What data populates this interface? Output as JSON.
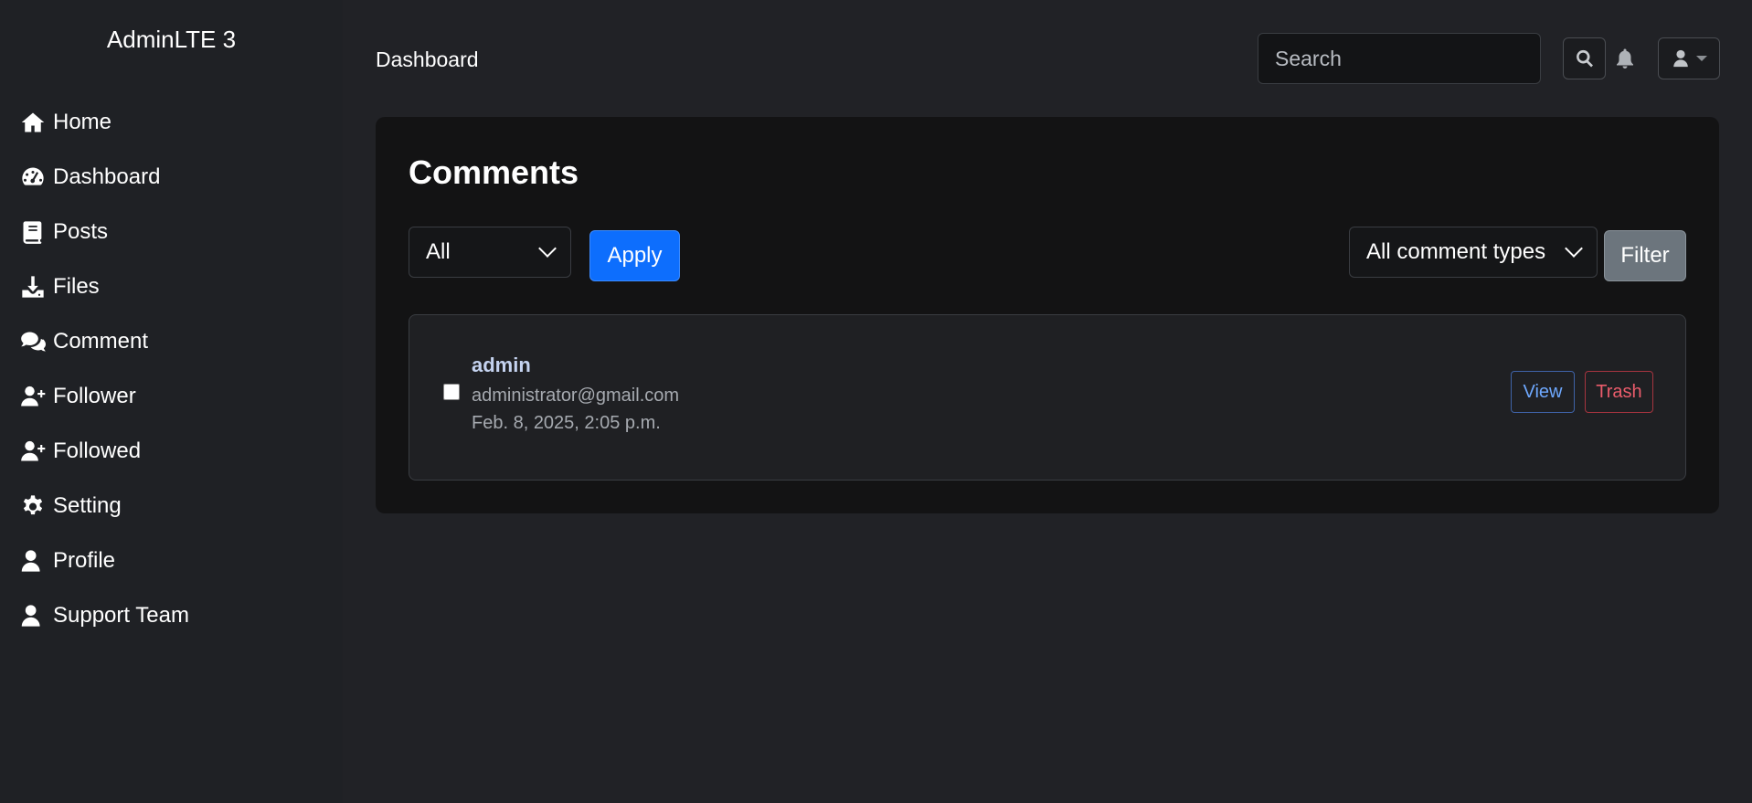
{
  "sidebar": {
    "brand": "AdminLTE 3",
    "items": [
      {
        "label": "Home",
        "icon": "home-icon"
      },
      {
        "label": "Dashboard",
        "icon": "gauge-icon"
      },
      {
        "label": "Posts",
        "icon": "book-icon"
      },
      {
        "label": "Files",
        "icon": "download-icon"
      },
      {
        "label": "Comment",
        "icon": "comments-icon"
      },
      {
        "label": "Follower",
        "icon": "user-plus-icon"
      },
      {
        "label": "Followed",
        "icon": "user-plus-icon"
      },
      {
        "label": "Setting",
        "icon": "gear-icon"
      },
      {
        "label": "Profile",
        "icon": "user-icon"
      },
      {
        "label": "Support Team",
        "icon": "user-icon"
      }
    ]
  },
  "header": {
    "page_label": "Dashboard",
    "search_placeholder": "Search"
  },
  "main": {
    "title": "Comments",
    "status_select": "All",
    "apply_label": "Apply",
    "type_select": "All comment types",
    "filter_label": "Filter",
    "comments": [
      {
        "author": "admin",
        "email": "administrator@gmail.com",
        "date": "Feb. 8, 2025, 2:05 p.m.",
        "view_label": "View",
        "trash_label": "Trash"
      }
    ]
  },
  "colors": {
    "accent": "#0d6efd",
    "secondary": "#6c757d",
    "danger": "#ea5c6b",
    "background": "#212226"
  }
}
